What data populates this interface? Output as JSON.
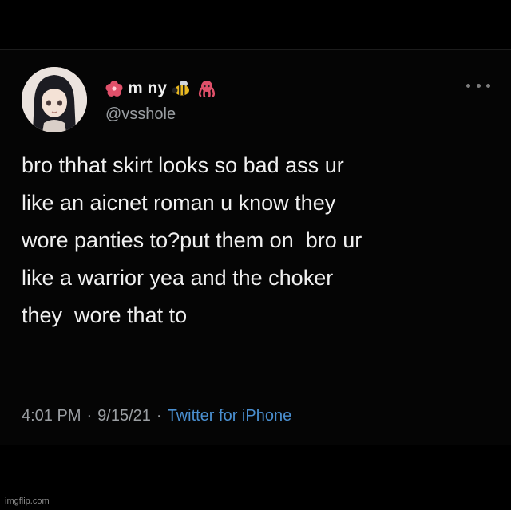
{
  "tweet": {
    "display_name": "m ny",
    "handle": "@vsshole",
    "name_emojis_left": [
      "hibiscus-icon"
    ],
    "name_emojis_right": [
      "bee-icon",
      "octopus-icon"
    ],
    "text_lines": [
      "bro thhat skirt looks so bad ass ur",
      "like an aicnet roman u know they",
      "wore panties to?put them on  bro ur",
      "like a warrior yea and the choker",
      "they  wore that to"
    ],
    "time": "4:01 PM",
    "date": "9/15/21",
    "separator": "·",
    "source": "Twitter for iPhone",
    "colors": {
      "background": "#000000",
      "text": "#f0f0f0",
      "muted": "#9a9ea2",
      "link": "#4a8fd0"
    }
  },
  "watermark": "imgflip.com"
}
